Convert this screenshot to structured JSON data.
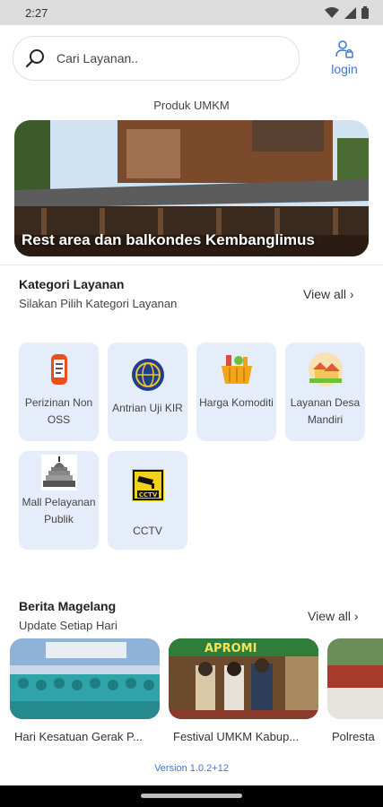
{
  "status_bar": {
    "time": "2:27"
  },
  "search": {
    "placeholder": "Cari Layanan.."
  },
  "login": {
    "label": "login"
  },
  "promo": {
    "section_label": "Produk UMKM",
    "banner_caption": "Rest area dan balkondes Kembanglimus"
  },
  "categories": {
    "title": "Kategori Layanan",
    "subtitle": "Silakan Pilih Kategori Layanan",
    "view_all": "View all",
    "items": [
      {
        "label": "Perizinan Non OSS",
        "icon": "phone-permit-icon"
      },
      {
        "label": "Antrian Uji KIR",
        "icon": "globe-emblem-icon"
      },
      {
        "label": "Harga Komoditi",
        "icon": "grocery-basket-icon"
      },
      {
        "label": "Layanan Desa Mandiri",
        "icon": "village-icon"
      },
      {
        "label": "Mall Pelayanan Publik",
        "icon": "temple-icon"
      },
      {
        "label": "CCTV",
        "icon": "cctv-icon"
      }
    ]
  },
  "news": {
    "title": "Berita Magelang",
    "subtitle": "Update Setiap Hari",
    "view_all": "View all",
    "items": [
      {
        "caption": "Hari Kesatuan Gerak P..."
      },
      {
        "caption": "Festival UMKM Kabup..."
      },
      {
        "caption": "Polresta"
      }
    ]
  },
  "footer": {
    "version": "Version 1.0.2+12"
  },
  "colors": {
    "accent": "#3b78d8",
    "tile_bg": "#e6edfa"
  }
}
